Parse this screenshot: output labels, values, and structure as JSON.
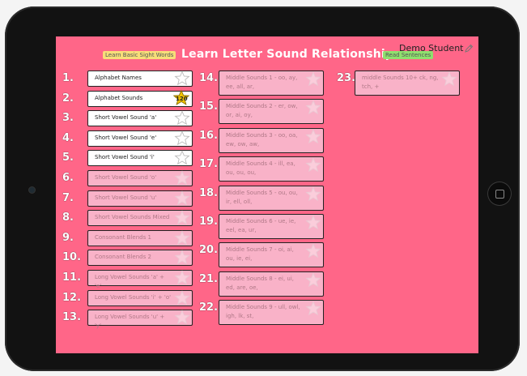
{
  "header": {
    "title": "Learn Letter Sound Relationships",
    "sight_words_link": "Learn Basic Sight Words",
    "sentences_link": "Read Sentences",
    "user_name": "Demo Student"
  },
  "lessons": [
    {
      "number": "1.",
      "label": "Alphabet Names",
      "active": true
    },
    {
      "number": "2.",
      "label": "Alphabet Sounds",
      "active": true,
      "badge": "120"
    },
    {
      "number": "3.",
      "label": "Short Vowel Sound 'a'",
      "active": true
    },
    {
      "number": "4.",
      "label": "Short Vowel Sound 'e'",
      "active": true
    },
    {
      "number": "5.",
      "label": "Short Vowel Sound 'i'",
      "active": true
    },
    {
      "number": "6.",
      "label": "Short Vowel Sound 'o'",
      "active": false
    },
    {
      "number": "7.",
      "label": "Short Vowel Sound 'u'",
      "active": false
    },
    {
      "number": "8.",
      "label": "Short Vowel Sounds Mixed",
      "active": false
    },
    {
      "number": "9.",
      "label": "Consonant Blends 1",
      "active": false
    },
    {
      "number": "10.",
      "label": "Consonant Blends 2",
      "active": false
    },
    {
      "number": "11.",
      "label": "Long Vowel Sounds 'a' + 'e'",
      "active": false
    },
    {
      "number": "12.",
      "label": "Long Vowel Sounds 'i' + 'o'",
      "active": false
    },
    {
      "number": "13.",
      "label": "Long Vowel Sounds 'u' + 'y'",
      "active": false
    },
    {
      "number": "14.",
      "label": "Middle Sounds 1 - oo, ay, ee, all, ar,",
      "active": false
    },
    {
      "number": "15.",
      "label": "Middle Sounds 2 - er, ow, or, ai, oy,",
      "active": false
    },
    {
      "number": "16.",
      "label": "Middle Sounds 3 - oo, oa, ew, ow, aw,",
      "active": false
    },
    {
      "number": "17.",
      "label": "Middle Sounds 4 - ill, ea, ou, ou, ou,",
      "active": false
    },
    {
      "number": "18.",
      "label": "Middle Sounds 5 - ou, ou, ir, ell, oll,",
      "active": false
    },
    {
      "number": "19.",
      "label": "Middle Sounds 6 - ue, ie, eel, ea, ur,",
      "active": false
    },
    {
      "number": "20.",
      "label": "Middle Sounds 7 - oi, ai, ou, ie, ei,",
      "active": false
    },
    {
      "number": "21.",
      "label": "Middle Sounds 8 - ei, ui, ed, are, oe,",
      "active": false
    },
    {
      "number": "22.",
      "label": "Middle Sounds 9 - ull, owl, igh, lk, st,",
      "active": false
    },
    {
      "number": "23.",
      "label": "middle Sounds 10+ ck, ng, tch, +",
      "active": false
    }
  ],
  "colors": {
    "background": "#ff6688",
    "card_active": "#ffffff",
    "card_locked": "#f9b2c8",
    "badge": "#f2c200"
  }
}
